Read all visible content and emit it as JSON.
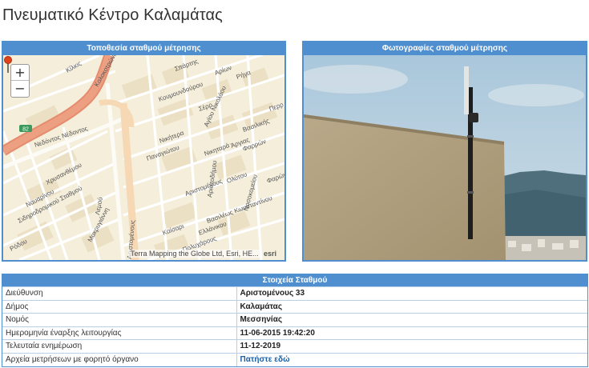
{
  "page": {
    "title": "Πνευματικό Κέντρο Καλαμάτας"
  },
  "map_panel": {
    "header": "Τοποθεσία σταθμού μέτρησης",
    "zoom_in": "+",
    "zoom_out": "−",
    "attribution": "Terra Mapping the Globe Ltd, Esri, HE...",
    "esri_logo": "esri",
    "road_shield": "82",
    "street_labels": [
      "Κίλκις",
      "Κολοκοτρώνη",
      "Νεδόντος Νέδοντος",
      "Σπάρτης",
      "Κουμουνδούρου",
      "Αγίου Νικολάου",
      "Σέρρ",
      "Ρήγα",
      "Περρ",
      "Αρίων",
      "Βασιλικής",
      "Φαρρών",
      "Νικήτερα",
      "Άργιας",
      "Νικηταρά",
      "Παναγιώτου",
      "Ολύτου",
      "Αριστοδήμου",
      "Φαρών",
      "Αριστομένους",
      "Χρυσανθέμου",
      "Καίσαρι",
      "Λεμού",
      "Ελλάνικου",
      "Σιδηροδρομικού Σταθμού",
      "Πολυχάρους",
      "Βασιλέως Κωνσταντίνου",
      "Νοσοκομείου",
      "Αριστομένους",
      "Μακρυγιάννη",
      "Ναυαρίνου",
      "Ρόδου"
    ]
  },
  "photo_panel": {
    "header": "Φωτογραφίες σταθμού μέτρησης"
  },
  "details": {
    "header": "Στοιχεία Σταθμού",
    "rows": [
      {
        "label": "Διεύθυνση",
        "value": "Αριστομένους 33"
      },
      {
        "label": "Δήμος",
        "value": "Καλαμάτας"
      },
      {
        "label": "Νομός",
        "value": "Μεσσηνίας"
      },
      {
        "label": "Ημερομηνία έναρξης λειτουργίας",
        "value": "11-06-2015 19:42:20"
      },
      {
        "label": "Τελευταία ενημέρωση",
        "value": "11-12-2019"
      },
      {
        "label": "Αρχεία μετρήσεων με φορητό όργανο",
        "value": "Πατήστε εδώ"
      }
    ]
  },
  "colors": {
    "accent": "#4f8fcf",
    "link": "#1a5fa8",
    "major_road": "#e9967a",
    "pin": "#e0441c"
  }
}
